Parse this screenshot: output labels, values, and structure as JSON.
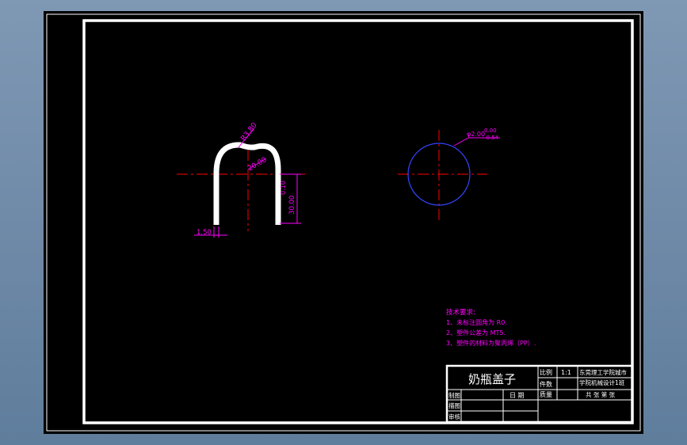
{
  "colors": {
    "background": "#000000",
    "frame": "#ffffff",
    "dimension": "#ff00ff",
    "centerline": "#ff0000",
    "circle": "#3344ff",
    "outer_bg": "#6f8aa6"
  },
  "drawing": {
    "dims": {
      "radius_top": "R3.80",
      "width_inner": "20.00",
      "height_a": "30.00",
      "height_b": "0.10",
      "wall": "1.50",
      "diameter": "φ2.00",
      "tol_upper": "0.00",
      "tol_lower": "-0.54"
    }
  },
  "notes": {
    "title": "技术要求:",
    "lines": [
      "1、未标注圆角为 R0.",
      "2、塑件公差为 MT5.",
      "3、塑件的材料为聚丙烯（PP）."
    ]
  },
  "title_block": {
    "part_name": "奶瓶盖子",
    "scale_label": "比例",
    "scale_value": "1:1",
    "material_label": "件数",
    "weight_label": "质量",
    "school_line1": "东莞理工学院城市",
    "school_line2": "学院机械设计1班",
    "sheet_text": "共 张 第 张",
    "rows": [
      "制图",
      "描图",
      "审核"
    ],
    "date_label": "日 期"
  }
}
